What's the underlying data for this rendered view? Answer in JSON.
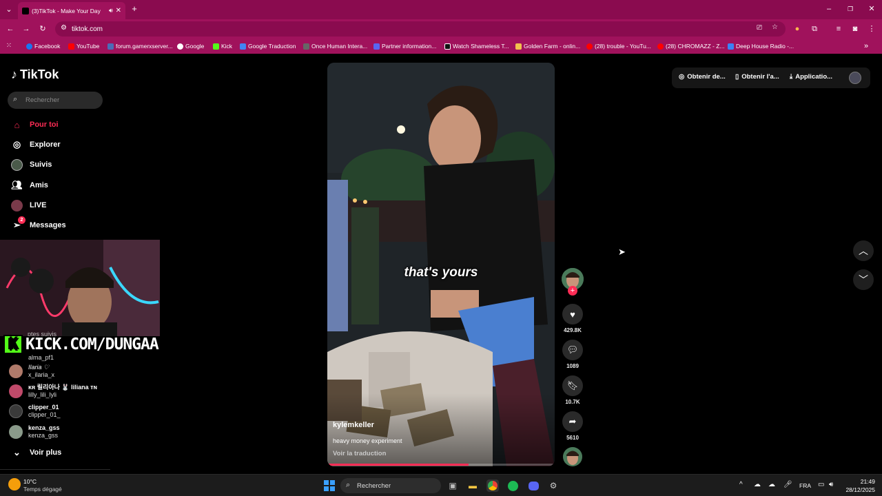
{
  "browser": {
    "tab_title": "(3)TikTok - Make Your Day",
    "url": "tiktok.com",
    "bookmarks": [
      {
        "label": "Facebook",
        "color": "#1877f2"
      },
      {
        "label": "YouTube",
        "color": "#ff0000"
      },
      {
        "label": "forum.gamerxserver...",
        "color": "#4b6cb7"
      },
      {
        "label": "Google",
        "color": "#ffffff"
      },
      {
        "label": "Kick",
        "color": "#53fc18"
      },
      {
        "label": "Google Traduction",
        "color": "#4285f4"
      },
      {
        "label": "Once Human Intera...",
        "color": "#666666"
      },
      {
        "label": "Partner information...",
        "color": "#5865f2"
      },
      {
        "label": "Watch Shameless T...",
        "color": "#111111"
      },
      {
        "label": "Golden Farm - onlin...",
        "color": "#f2c14e"
      },
      {
        "label": "(28) trouble - YouTu...",
        "color": "#ff0000"
      },
      {
        "label": "(28) CHROMAZZ - Z...",
        "color": "#ff0000"
      },
      {
        "label": "Deep House Radio -...",
        "color": "#3b82f6"
      }
    ]
  },
  "tiktok": {
    "logo": "TikTok",
    "search_placeholder": "Rechercher",
    "nav": [
      {
        "label": "Pour toi",
        "icon": "home-icon",
        "active": true
      },
      {
        "label": "Explorer",
        "icon": "compass-icon",
        "active": false
      },
      {
        "label": "Suivis",
        "icon": "avatar-icon",
        "active": false
      },
      {
        "label": "Amis",
        "icon": "friends-icon",
        "active": false
      },
      {
        "label": "LIVE",
        "icon": "live-icon",
        "active": false
      },
      {
        "label": "Messages",
        "icon": "messages-icon",
        "active": false,
        "badge": "2"
      }
    ],
    "overlay_banner": "KICK.COM/DUNGAA",
    "following_header_partial": "ptes suivis",
    "following": [
      {
        "user": "alma_pf1",
        "name": "",
        "color": "#7a4a3a"
      },
      {
        "user": "Ilaria ♡",
        "name": "x_ilaria_x",
        "color": "#b07a6a"
      },
      {
        "user": "ᴋʀ 릴리아나 🐰 liliana ᴛɴ",
        "name": "lilly_lili_lyli",
        "color": "#c04a6a"
      },
      {
        "user": "clipper_01",
        "name": "clipper_01_",
        "color": "#3a3a3a"
      },
      {
        "user": "kenza_gss",
        "name": "kenza_gss",
        "color": "#8a9a8a"
      }
    ],
    "see_more": "Voir plus",
    "video": {
      "caption": "that's yours",
      "username": "kylemkeller",
      "description": "heavy money experiment",
      "translate": "Voir la traduction",
      "progress": 0.62
    },
    "actions": {
      "likes": "429.8K",
      "comments": "1089",
      "saves": "10.7K",
      "shares": "5610"
    },
    "topbar": {
      "coins": "Obtenir de...",
      "app": "Obtenir l'a...",
      "download": "Applicatio..."
    }
  },
  "taskbar": {
    "weather_temp": "10°C",
    "weather_desc": "Temps dégagé",
    "search_label": "Rechercher",
    "language": "FRA",
    "time": "21:49",
    "date": "28/12/2025"
  }
}
